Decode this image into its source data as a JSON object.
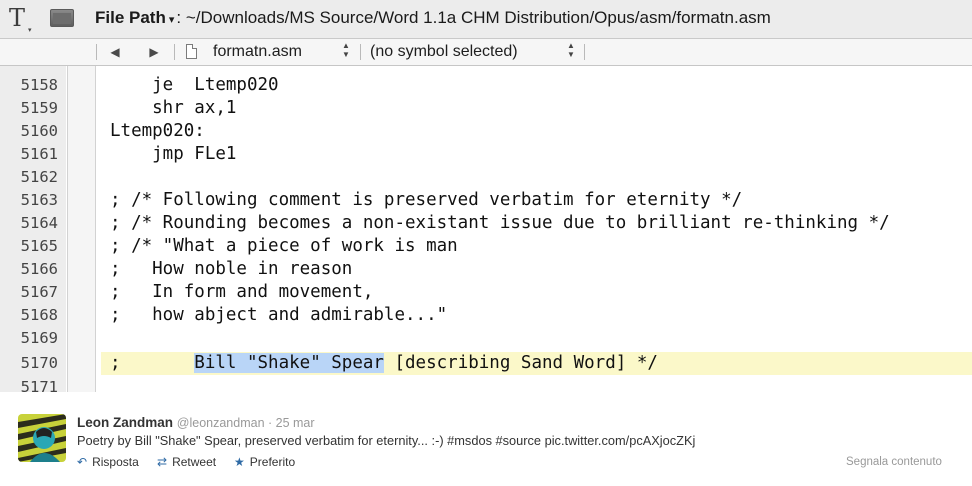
{
  "titlebar": {
    "path_label": "File Path",
    "path_caret": "▾",
    "path_value": ": ~/Downloads/MS Source/Word 1.1a CHM Distribution/Opus/asm/formatn.asm"
  },
  "navbar": {
    "back_glyph": "◀",
    "forward_glyph": "▶",
    "file_name": "formatn.asm",
    "symbol": "(no symbol selected)"
  },
  "editor": {
    "lines": [
      {
        "num": "5158",
        "code": "    je  Ltemp020"
      },
      {
        "num": "5159",
        "code": "    shr ax,1"
      },
      {
        "num": "5160",
        "code": "Ltemp020:"
      },
      {
        "num": "5161",
        "code": "    jmp FLe1"
      },
      {
        "num": "5162",
        "code": ""
      },
      {
        "num": "5163",
        "code": "; /* Following comment is preserved verbatim for eternity */"
      },
      {
        "num": "5164",
        "code": "; /* Rounding becomes a non-existant issue due to brilliant re-thinking */"
      },
      {
        "num": "5165",
        "code": "; /* \"What a piece of work is man"
      },
      {
        "num": "5166",
        "code": ";   How noble in reason"
      },
      {
        "num": "5167",
        "code": ";   In form and movement,"
      },
      {
        "num": "5168",
        "code": ";   how abject and admirable...\""
      },
      {
        "num": "5169",
        "code": ""
      },
      {
        "num": "5170",
        "code_pre": ";       ",
        "code_sel": "Bill \"Shake\" Spear",
        "code_post": " [describing Sand Word] */"
      },
      {
        "num": "5171",
        "code": ""
      }
    ],
    "highlight_color": "#fbf8c9",
    "selection_color": "#b9d5f7"
  },
  "tweet": {
    "name": "Leon Zandman",
    "handle": "@leonzandman",
    "separator": " · ",
    "date": "25 mar",
    "text": "Poetry by Bill \"Shake\" Spear, preserved verbatim for eternity... :-) #msdos #source pic.twitter.com/pcAXjocZKj",
    "reply_label": "Risposta",
    "retweet_label": "Retweet",
    "favorite_label": "Preferito",
    "report_label": "Segnala contenuto",
    "action_color": "#2e6aa5"
  }
}
